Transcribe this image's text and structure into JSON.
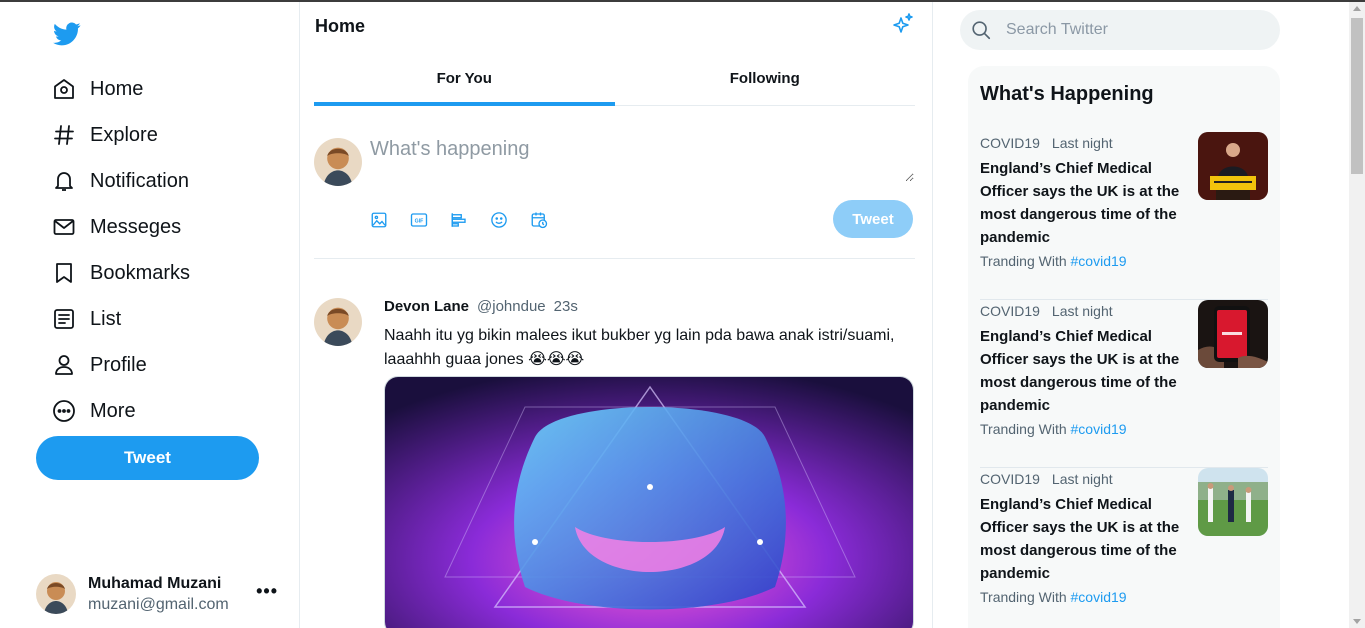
{
  "colors": {
    "brand": "#1d9bf0",
    "brand_disabled": "#8ecdf8",
    "text": "#0f1419",
    "muted": "#536471",
    "border": "#e6ecf0",
    "panel": "#f7f9f9"
  },
  "sidebar": {
    "logo_icon": "twitter-bird-icon",
    "items": [
      {
        "label": "Home",
        "icon": "home-icon"
      },
      {
        "label": "Explore",
        "icon": "hashtag-icon"
      },
      {
        "label": "Notification",
        "icon": "bell-icon"
      },
      {
        "label": "Messeges",
        "icon": "envelope-icon"
      },
      {
        "label": "Bookmarks",
        "icon": "bookmark-icon"
      },
      {
        "label": "List",
        "icon": "list-icon"
      },
      {
        "label": "Profile",
        "icon": "user-icon"
      },
      {
        "label": "More",
        "icon": "more-circle-icon"
      }
    ],
    "tweet_label": "Tweet",
    "account": {
      "name": "Muhamad Muzani",
      "email": "muzani@gmail.com",
      "more": "•••"
    }
  },
  "main": {
    "title": "Home",
    "tabs": [
      {
        "label": "For You",
        "active": true
      },
      {
        "label": "Following",
        "active": false
      }
    ],
    "composer": {
      "placeholder": "What's happening",
      "tools": [
        "image-icon",
        "gif-icon",
        "poll-icon",
        "emoji-icon",
        "schedule-icon"
      ],
      "tweet_label": "Tweet"
    },
    "post": {
      "name": "Devon Lane",
      "handle": "@johndue",
      "time": "23s",
      "text": "Naahh itu yg bikin malees ikut bukber yg lain pda bawa anak istri/suami, laaahhh guaa jones 😭😭😭",
      "media_icon": "astronaut-artwork"
    }
  },
  "right": {
    "search_placeholder": "Search Twitter",
    "trends_title": "What's Happening",
    "trends": [
      {
        "topic": "COVID19",
        "time": "Last night",
        "headline": "England’s Chief Medical Officer says the UK is at the most dangerous time of the pandemic",
        "prefix": "Tranding With",
        "tag": "#covid19"
      },
      {
        "topic": "COVID19",
        "time": "Last night",
        "headline": "England’s Chief Medical Officer says the UK is at the most dangerous time of the pandemic",
        "prefix": "Tranding With",
        "tag": "#covid19"
      },
      {
        "topic": "COVID19",
        "time": "Last night",
        "headline": "England’s Chief Medical Officer says the UK is at the most dangerous time of the pandemic",
        "prefix": "Tranding With",
        "tag": "#covid19"
      }
    ]
  }
}
